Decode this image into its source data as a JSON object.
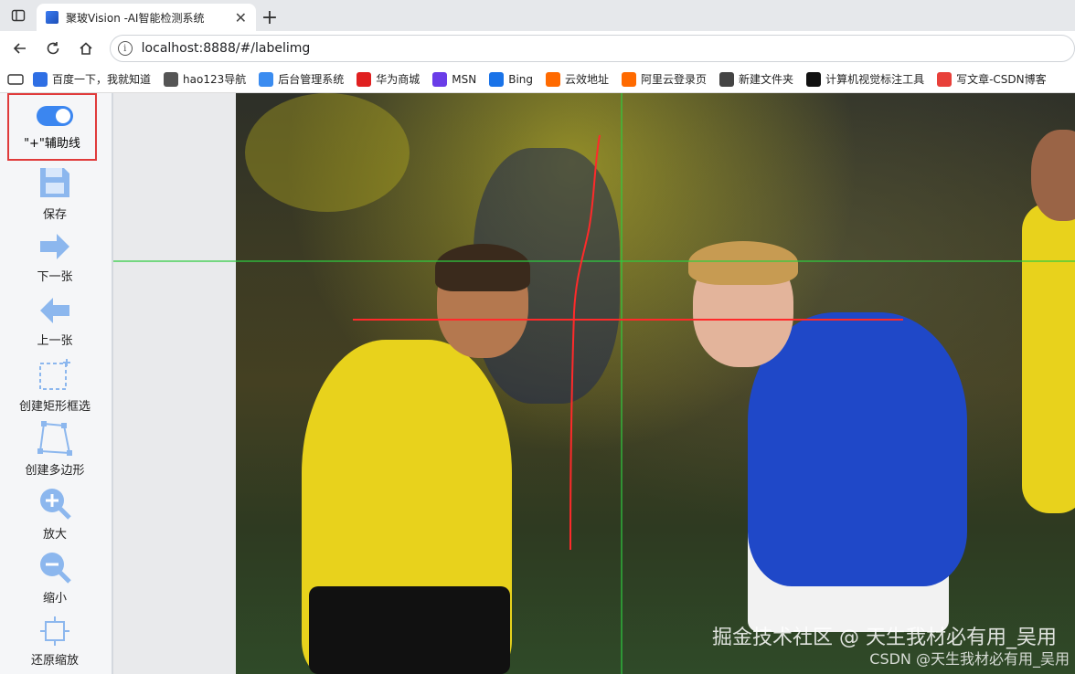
{
  "browser": {
    "tab_title": "聚玻Vision -AI智能检测系统",
    "tab_close": "✕",
    "new_tab": "+",
    "url": "localhost:8888/#/labelimg"
  },
  "bookmarks": [
    {
      "label": "百度一下，我就知道",
      "icon": "baidu-icon",
      "color": "#2f6fe4"
    },
    {
      "label": "hao123导航",
      "icon": "globe-icon",
      "color": "#555555"
    },
    {
      "label": "后台管理系统",
      "icon": "app-icon",
      "color": "#3b8cf0"
    },
    {
      "label": "华为商城",
      "icon": "huawei-icon",
      "color": "#e02020"
    },
    {
      "label": "MSN",
      "icon": "msn-icon",
      "color": "#6a3de8"
    },
    {
      "label": "Bing",
      "icon": "search-icon",
      "color": "#1a73e8"
    },
    {
      "label": "云效地址",
      "icon": "aliyun-icon",
      "color": "#ff6a00"
    },
    {
      "label": "阿里云登录页",
      "icon": "aliyun-icon",
      "color": "#ff6a00"
    },
    {
      "label": "新建文件夹",
      "icon": "folder-icon",
      "color": "#444444"
    },
    {
      "label": "计算机视觉标注工具",
      "icon": "tool-icon",
      "color": "#111111"
    },
    {
      "label": "写文章-CSDN博客",
      "icon": "csdn-icon",
      "color": "#e8403a"
    }
  ],
  "sidebar": {
    "toggle_label": "\"+\"辅助线",
    "toggle_on": true,
    "tools": [
      {
        "label": "保存",
        "icon": "save-icon"
      },
      {
        "label": "下一张",
        "icon": "arrow-right-icon"
      },
      {
        "label": "上一张",
        "icon": "arrow-left-icon"
      },
      {
        "label": "创建矩形框选",
        "icon": "rectangle-add-icon"
      },
      {
        "label": "创建多边形",
        "icon": "polygon-icon"
      },
      {
        "label": "放大",
        "icon": "zoom-in-icon"
      },
      {
        "label": "缩小",
        "icon": "zoom-out-icon"
      },
      {
        "label": "还原缩放",
        "icon": "zoom-reset-icon"
      }
    ]
  },
  "watermark": {
    "main": "掘金技术社区 @ 天生我材必有用_吴用",
    "sub": "CSDN @天生我材必有用_吴用"
  },
  "colors": {
    "accent": "#3b86f0",
    "highlight_border": "#e03b3b",
    "guide_line": "#2ecc40",
    "annotation_line": "#ff2a2a"
  }
}
